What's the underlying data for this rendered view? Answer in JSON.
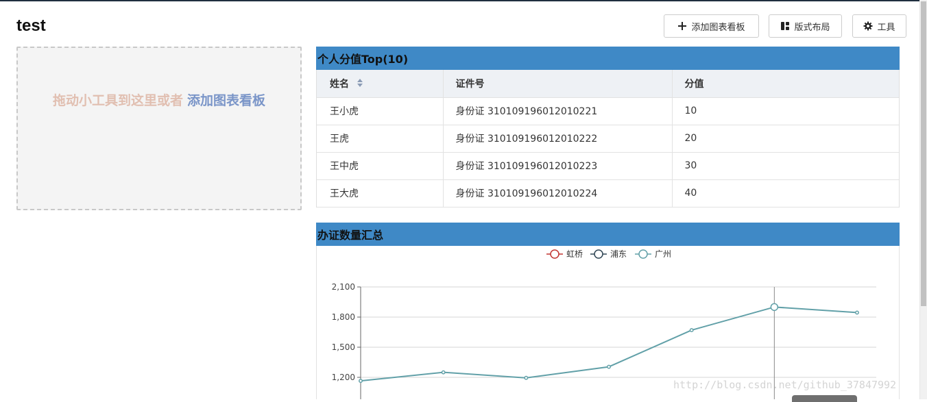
{
  "page": {
    "title": "test"
  },
  "toolbar": {
    "add_label": "添加图表看板",
    "layout_label": "版式布局",
    "tools_label": "工具"
  },
  "dropzone": {
    "text": "拖动小工具到这里或者",
    "link": "添加图表看板"
  },
  "panel1": {
    "title": "个人分值Top(10)",
    "columns": [
      "姓名",
      "证件号",
      "分值"
    ],
    "rows": [
      [
        "王小虎",
        "身份证 310109196012010221",
        "10"
      ],
      [
        "王虎",
        "身份证 310109196012010222",
        "20"
      ],
      [
        "王中虎",
        "身份证 310109196012010223",
        "30"
      ],
      [
        "王大虎",
        "身份证 310109196012010224",
        "40"
      ]
    ]
  },
  "panel2": {
    "title": "办证数量汇总"
  },
  "chart_data": {
    "type": "line",
    "legend": [
      "虹桥",
      "浦东",
      "广州"
    ],
    "legend_colors": [
      "#c23531",
      "#2f4554",
      "#61a0a8"
    ],
    "legend_position": "top-center",
    "yticks": [
      "2,100",
      "1,800",
      "1,500",
      "1,200"
    ],
    "ylim": [
      1200,
      2100
    ],
    "grid": true,
    "series": [
      {
        "name": "广州",
        "color": "#61a0a8",
        "values": [
          1165,
          1250,
          1195,
          1305,
          1670,
          1900,
          1845
        ]
      }
    ],
    "highlight_index": 5
  },
  "watermark": "http://blog.csdn.net/github_37847992"
}
